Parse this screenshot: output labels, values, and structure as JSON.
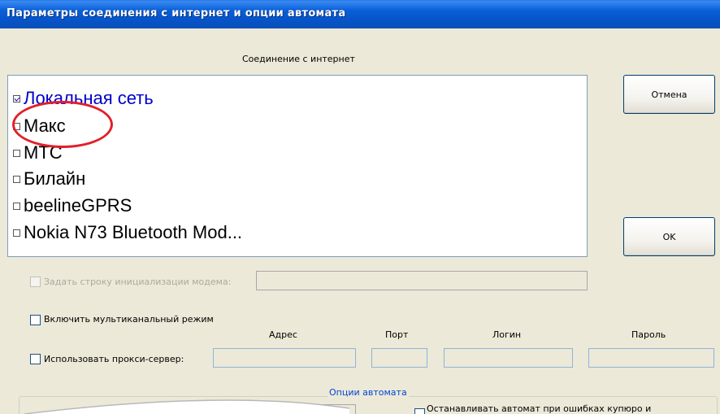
{
  "window": {
    "title": "Параметры соединения с интернет и опции автомата"
  },
  "connection": {
    "section_title": "Соединение с интернет",
    "items": [
      {
        "label": "Локальная сеть",
        "checked": true
      },
      {
        "label": "Макс",
        "checked": false
      },
      {
        "label": "МТС",
        "checked": false
      },
      {
        "label": "Билайн",
        "checked": false
      },
      {
        "label": "beelineGPRS",
        "checked": false
      },
      {
        "label": "Nokia N73 Bluetooth Mod...",
        "checked": false
      }
    ]
  },
  "buttons": {
    "cancel": "Отмена",
    "ok": "OK"
  },
  "modem": {
    "init_label": "Задать строку инициализации модема:",
    "init_value": ""
  },
  "multichannel": {
    "label": "Включить мультиканальный режим"
  },
  "proxy": {
    "label": "Использовать прокси-сервер:",
    "columns": {
      "address": "Адрес",
      "port": "Порт",
      "login": "Логин",
      "password": "Пароль"
    },
    "values": {
      "address": "",
      "port": "",
      "login": "",
      "password": ""
    }
  },
  "automat": {
    "group_title": "Опции автомата",
    "stop_on_errors_label": "Останавливать автомат при ошибках купюро и"
  },
  "colors": {
    "titlebar": "#0a5fd8",
    "selected_item": "#0000cc",
    "highlight_circle": "#e0202a",
    "group_title": "#0046d5"
  }
}
